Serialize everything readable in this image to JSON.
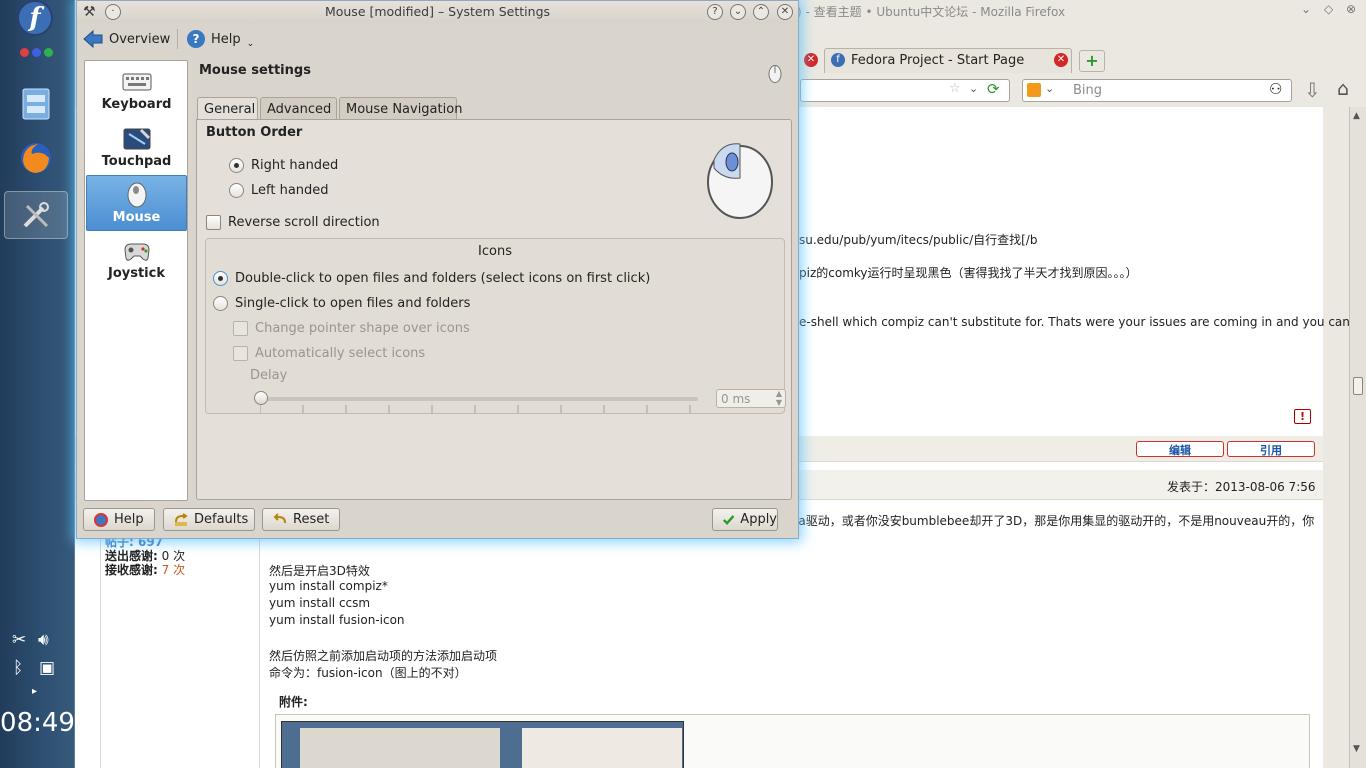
{
  "desktop": {
    "clock": "08:49"
  },
  "firefox": {
    "window_title": ") - 查看主题 • Ubuntu中文论坛 - Mozilla Firefox",
    "tabs": [
      {
        "label": "Fedora Project - Start Page"
      }
    ],
    "search": {
      "placeholder": "Bing"
    },
    "lines": [
      "su.edu/pub/yum/itecs/public/自行查找[/b",
      "piz的comky运行时呈现黑色（害得我找了半天才找到原因。。。）",
      "e-shell which compiz can't substitute for. Thats were your issues are coming in and you can"
    ],
    "edit_button": "编辑",
    "quote_button": "引用",
    "post_meta": "发表于：2013-08-06 7:56",
    "post_lead": "ia驱动，或者你没安bumblebee却开了3D，那是你用集显的驱动开的，不是用nouveau开的，你",
    "user_stats": {
      "posts_label": "帖子:",
      "posts": "697",
      "thanks_given_label": "送出感谢:",
      "thanks_given": "0 次",
      "thanks_received_label": "接收感谢:",
      "thanks_received": "7 次"
    },
    "post_lines": [
      "然后是开启3D特效",
      "yum install compiz*",
      "yum install ccsm",
      "yum install fusion-icon",
      "",
      "然后仿照之前添加启动项的方法添加启动项",
      "命令为：fusion-icon（图上的不对）"
    ],
    "attachment_label": "附件:"
  },
  "settings": {
    "title": "Mouse [modified] – System Settings",
    "toolbar": {
      "overview": "Overview",
      "help": "Help"
    },
    "sidebar": [
      {
        "label": "Keyboard",
        "icon": "keyboard-icon"
      },
      {
        "label": "Touchpad",
        "icon": "touchpad-icon"
      },
      {
        "label": "Mouse",
        "icon": "mouse-icon",
        "selected": true
      },
      {
        "label": "Joystick",
        "icon": "joystick-icon"
      }
    ],
    "page_title": "Mouse settings",
    "tabs": [
      "General",
      "Advanced",
      "Mouse Navigation"
    ],
    "button_order": {
      "heading": "Button Order",
      "right": "Right handed",
      "left": "Left handed",
      "selected": "right"
    },
    "reverse_scroll": "Reverse scroll direction",
    "icons_group": {
      "title": "Icons",
      "double_click": "Double-click to open files and folders (select icons on first click)",
      "single_click": "Single-click to open files and folders",
      "change_pointer": "Change pointer shape over icons",
      "auto_select": "Automatically select icons",
      "delay_label": "Delay",
      "delay_value": "0 ms"
    },
    "buttons": {
      "help": "Help",
      "defaults": "Defaults",
      "reset": "Reset",
      "apply": "Apply"
    },
    "colors": {
      "accent": "#4c8ed2",
      "glow": "#5bc4ff"
    }
  }
}
